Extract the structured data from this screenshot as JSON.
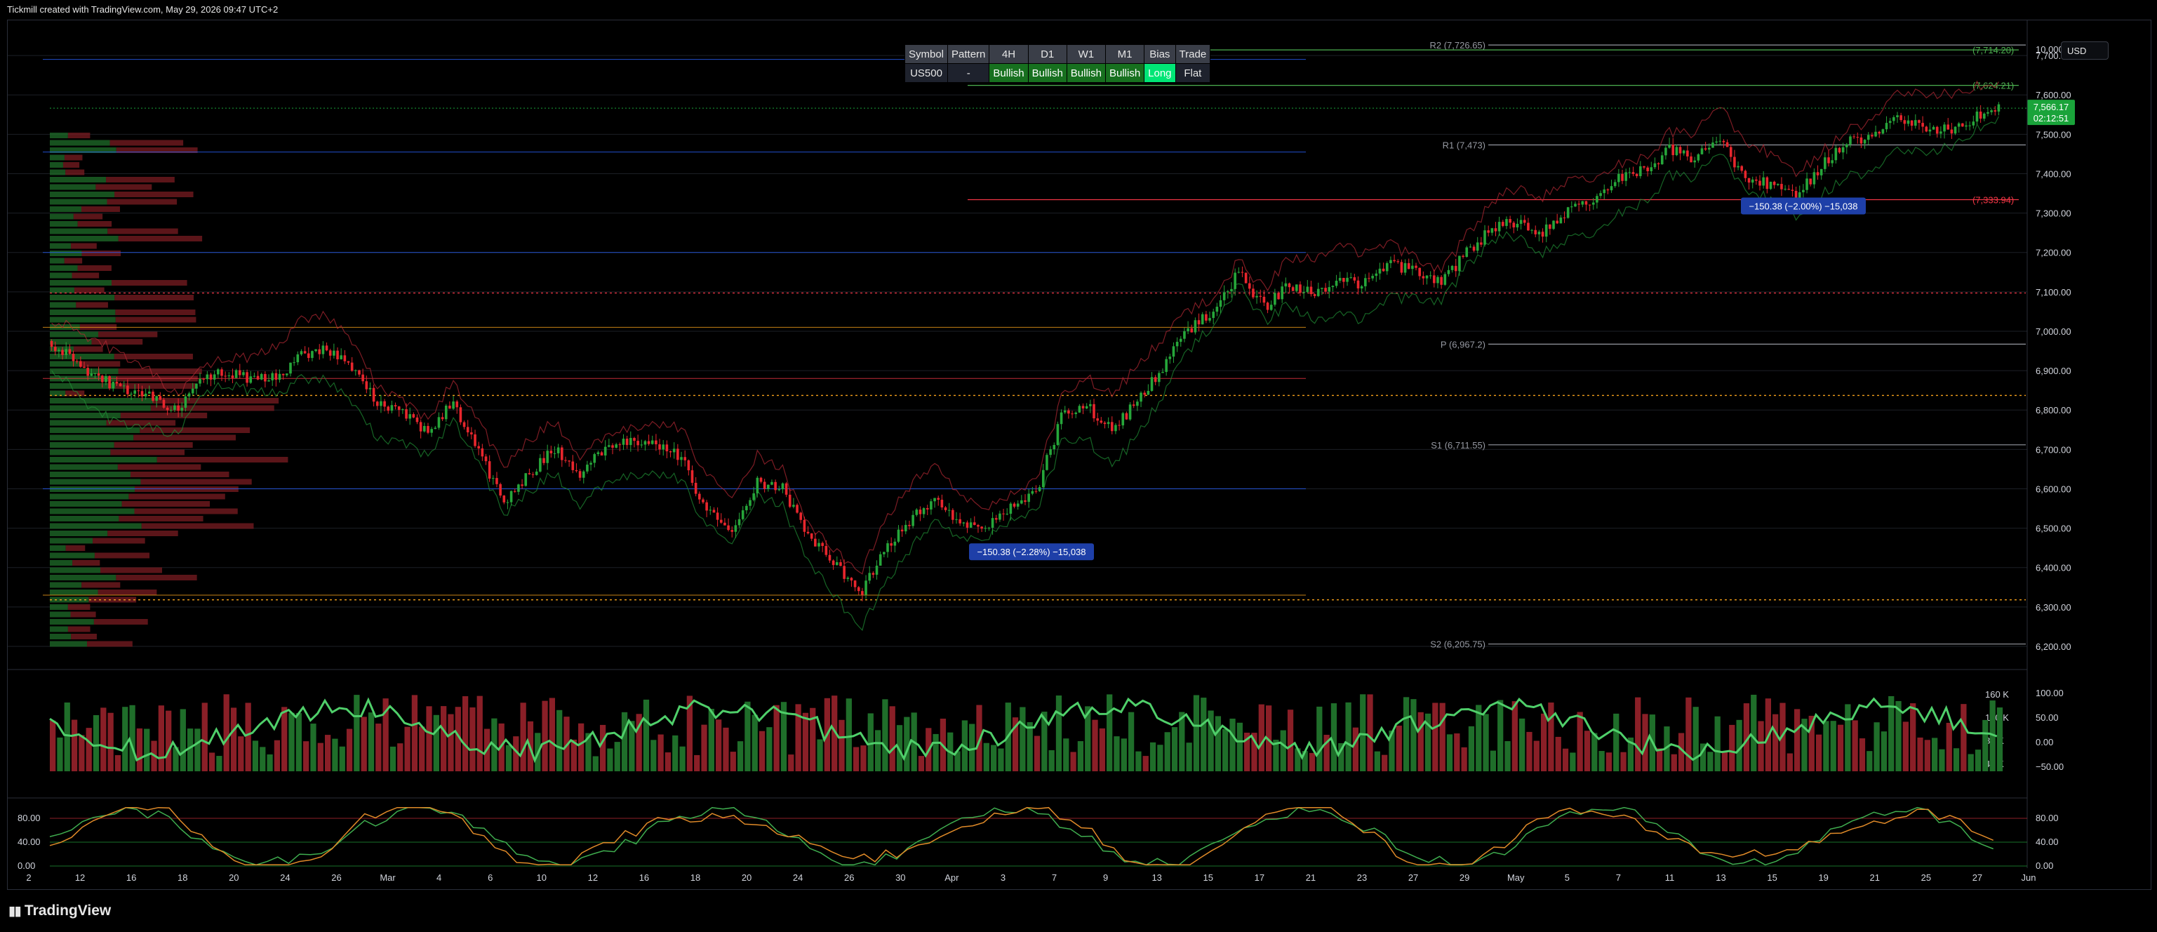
{
  "header": {
    "attribution": "Tickmill created with TradingView.com, May 29, 2026 09:47 UTC+2"
  },
  "signal_table": {
    "headers": [
      "Symbol",
      "Pattern",
      "4H",
      "D1",
      "W1",
      "M1",
      "Bias",
      "Trade"
    ],
    "values": [
      "US500",
      "-",
      "Bullish",
      "Bullish",
      "Bullish",
      "Bullish",
      "Long",
      "Flat"
    ]
  },
  "currency": "USD",
  "footer": {
    "logo_text": "TradingView"
  },
  "colors": {
    "bull": "#26a63a",
    "bear": "#e8262d",
    "background": "#000000",
    "grid": "#1c1f26",
    "text": "#d1d4dc",
    "price_label": "#1aa33a"
  },
  "chart_data": [
    {
      "type": "candlestick",
      "symbol": "US500",
      "ylim": [
        6150,
        7750
      ],
      "y_ticks": [
        "7,700.00",
        "7,600.00",
        "7,500.00",
        "7,400.00",
        "7,300.00",
        "7,200.00",
        "7,100.00",
        "7,000.00",
        "6,900.00",
        "6,800.00",
        "6,700.00",
        "6,600.00",
        "6,500.00",
        "6,400.00",
        "6,300.00",
        "6,200.00"
      ],
      "top_tick": "10,000.00",
      "x_ticks": [
        "2",
        "12",
        "16",
        "18",
        "20",
        "24",
        "26",
        "Mar",
        "4",
        "6",
        "10",
        "12",
        "16",
        "18",
        "20",
        "24",
        "26",
        "30",
        "Apr",
        "3",
        "7",
        "9",
        "13",
        "15",
        "17",
        "21",
        "23",
        "27",
        "29",
        "May",
        "5",
        "7",
        "11",
        "13",
        "15",
        "19",
        "21",
        "25",
        "27",
        "Jun"
      ],
      "price_path": [
        6975,
        6930,
        6880,
        6850,
        6840,
        6800,
        6870,
        6900,
        6880,
        6880,
        6940,
        6960,
        6900,
        6820,
        6800,
        6740,
        6820,
        6690,
        6570,
        6640,
        6700,
        6640,
        6700,
        6720,
        6720,
        6680,
        6540,
        6490,
        6620,
        6600,
        6480,
        6420,
        6330,
        6440,
        6520,
        6570,
        6520,
        6500,
        6560,
        6590,
        6780,
        6810,
        6750,
        6820,
        6910,
        7000,
        7050,
        7150,
        7060,
        7120,
        7090,
        7130,
        7120,
        7170,
        7150,
        7120,
        7200,
        7260,
        7280,
        7250,
        7310,
        7340,
        7390,
        7410,
        7460,
        7440,
        7480,
        7390,
        7370,
        7340,
        7420,
        7480,
        7500,
        7540,
        7520,
        7510,
        7540,
        7570
      ],
      "last_price": "7,566.17",
      "countdown": "02:12:51",
      "pivots": [
        {
          "label": "R2 (7,726.65)",
          "value": 7726.65
        },
        {
          "label": "R1 (7,473)",
          "value": 7473
        },
        {
          "label": "P (6,967.2)",
          "value": 6967.2
        },
        {
          "label": "S1 (6,711.55)",
          "value": 6711.55
        },
        {
          "label": "S2 (6,205.75)",
          "value": 6205.75
        }
      ],
      "trade_levels": [
        {
          "label": "(7,714.20)",
          "value": 7714.2,
          "color": "#4caf50"
        },
        {
          "label": "(7,624.21)",
          "value": 7624.21,
          "color": "#4caf50"
        },
        {
          "label": "(7,333.94)",
          "value": 7333.94,
          "color": "#f23645"
        }
      ],
      "measurements": [
        {
          "label": "−150.38 (−2.28%) −15,038",
          "value": 6440
        },
        {
          "label": "−150.38 (−2.00%) −15,038",
          "value": 7318
        }
      ]
    },
    {
      "type": "volume+oscillator",
      "y_ticks_left": [
        "160 K",
        "120 K",
        "80 K",
        "40 K"
      ],
      "y_ticks_right": [
        "100.00",
        "50.00",
        "0.00",
        "−50.00"
      ]
    },
    {
      "type": "stochastic",
      "y_ticks_left": [
        "80.00",
        "40.00",
        "0.00"
      ],
      "y_ticks_right": [
        "80.00",
        "40.00",
        "0.00"
      ]
    }
  ]
}
